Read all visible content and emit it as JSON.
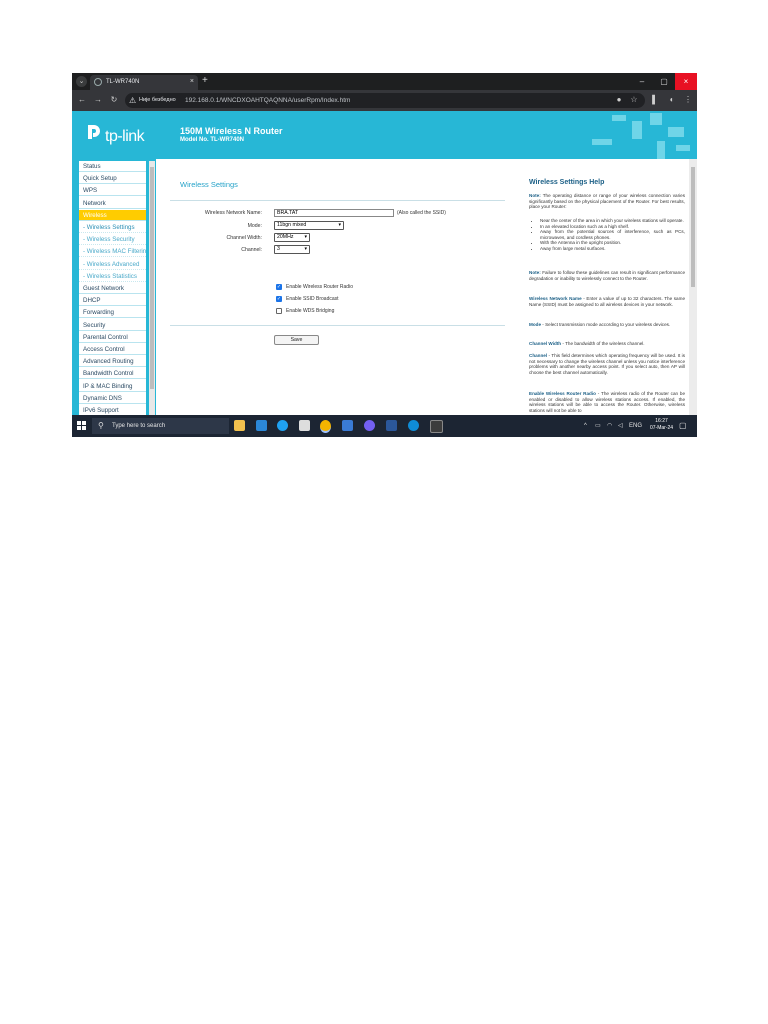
{
  "browser": {
    "tab_title": "TL-WR740N",
    "tab_close": "×",
    "new_tab": "+",
    "menu_glyph": "⌄",
    "win_min": "–",
    "win_max": "▢",
    "win_close": "×",
    "back": "←",
    "forward": "→",
    "reload": "↻",
    "security_warning": "⚠",
    "not_secure_label": "Није безбедно",
    "url": "192.168.0.1/WNCDXOAHTQAQNNA/userRpm/Index.htm"
  },
  "router": {
    "logo_text": "tp-link",
    "product_title": "150M Wireless N Router",
    "model_line": "Model No. TL-WR740N",
    "colors": {
      "brand": "#27b7d6",
      "active_menu": "#ffcc00"
    }
  },
  "menu": {
    "items": [
      {
        "label": "Status"
      },
      {
        "label": "Quick Setup"
      },
      {
        "label": "WPS"
      },
      {
        "label": "Network"
      },
      {
        "label": "Wireless",
        "active": true
      },
      {
        "label": "- Wireless Settings",
        "sub": true,
        "selected": true
      },
      {
        "label": "- Wireless Security",
        "sub": true
      },
      {
        "label": "- Wireless MAC Filtering",
        "sub": true
      },
      {
        "label": "- Wireless Advanced",
        "sub": true
      },
      {
        "label": "- Wireless Statistics",
        "sub": true
      },
      {
        "label": "Guest Network"
      },
      {
        "label": "DHCP"
      },
      {
        "label": "Forwarding"
      },
      {
        "label": "Security"
      },
      {
        "label": "Parental Control"
      },
      {
        "label": "Access Control"
      },
      {
        "label": "Advanced Routing"
      },
      {
        "label": "Bandwidth Control"
      },
      {
        "label": "IP & MAC Binding"
      },
      {
        "label": "Dynamic DNS"
      },
      {
        "label": "IPv6 Support"
      }
    ]
  },
  "form": {
    "title": "Wireless Settings",
    "ssid_label": "Wireless Network Name:",
    "ssid_value": "BRA.TAT",
    "ssid_note": "(Also called the SSID)",
    "mode_label": "Mode:",
    "mode_value": "11bgn mixed",
    "width_label": "Channel Width:",
    "width_value": "20MHz",
    "channel_label": "Channel:",
    "channel_value": "3",
    "enable_radio": {
      "label": "Enable Wireless Router Radio",
      "checked": true
    },
    "enable_ssid": {
      "label": "Enable SSID Broadcast",
      "checked": true
    },
    "enable_wds": {
      "label": "Enable WDS Bridging",
      "checked": false
    },
    "save_label": "Save",
    "check_glyph": "✓"
  },
  "help": {
    "title": "Wireless Settings Help",
    "note1_label": "Note:",
    "note1_text": "The operating distance or range of your wireless connection varies significantly based on the physical placement of the Router. For best results, place your Router:",
    "bullets": [
      "Near the center of the area in which your wireless stations will operate.",
      "In an elevated location such as a high shelf.",
      "Away from the potential sources of interference, such as PCs, microwaves, and cordless phones.",
      "With the Antenna in the upright position.",
      "Away from large metal surfaces."
    ],
    "note2_label": "Note:",
    "note2_text": "Failure to follow these guidelines can result in significant performance degradation or inability to wirelessly connect to the Router.",
    "ssid_label": "Wireless Network Name",
    "ssid_text": "- Enter a value of up to 32 characters. The same Name (SSID) must be assigned to all wireless devices in your network.",
    "mode_label": "Mode",
    "mode_text": "- Select transmission mode according to your wireless devices.",
    "width_label": "Channel Width",
    "width_text": "- The bandwidth of the wireless channel.",
    "channel_label": "Channel",
    "channel_text": "- This field determines which operating frequency will be used. It is not necessary to change the wireless channel unless you notice interference problems with another nearby access point. If you select auto, then AP will choose the best channel automatically.",
    "radio_label": "Enable Wireless Router Radio",
    "radio_text": "- The wireless radio of the Router can be enabled or disabled to allow wireless stations access. If enabled, the wireless stations will be able to access the Router. Otherwise, wireless stations will not be able to"
  },
  "taskbar": {
    "search_placeholder": "Type here to search",
    "search_icon": "⚲",
    "tray_chevron": "^",
    "language": "ENG",
    "time": "16:27",
    "date": "07-Mar-24",
    "notification_icon": "▢"
  }
}
